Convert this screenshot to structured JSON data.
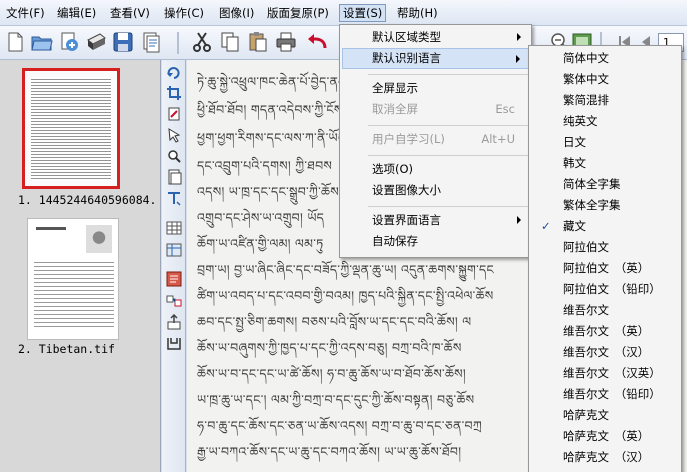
{
  "menubar": {
    "items": [
      "文件(F)",
      "编辑(E)",
      "查看(V)",
      "操作(C)",
      "图像(I)",
      "版面复原(P)",
      "设置(S)",
      "帮助(H)"
    ]
  },
  "thumbnails": {
    "items": [
      {
        "label": "1. 1445244640596084.",
        "selected": true
      },
      {
        "label": "2. Tibetan.tif",
        "selected": false
      }
    ]
  },
  "settings_menu": {
    "items": [
      {
        "label": "默认区域类型",
        "submenu": true
      },
      {
        "label": "默认识别语言",
        "submenu": true,
        "highlighted": true
      },
      {
        "label": "全屏显示"
      },
      {
        "label": "取消全屏",
        "shortcut": "Esc",
        "disabled": true
      },
      {
        "label": "用户自学习(L)",
        "shortcut": "Alt+U",
        "disabled": true
      },
      {
        "label": "选项(O)"
      },
      {
        "label": "设置图像大小"
      },
      {
        "label": "设置界面语言",
        "submenu": true
      },
      {
        "label": "自动保存"
      }
    ]
  },
  "language_menu": {
    "items": [
      "简体中文",
      "繁体中文",
      "繁简混排",
      "纯英文",
      "日文",
      "韩文",
      "简体全字集",
      "繁体全字集",
      "藏文",
      "阿拉伯文",
      "阿拉伯文　（英）",
      "阿拉伯文　（铅印）",
      "维吾尔文",
      "维吾尔文　（英）",
      "维吾尔文　（汉）",
      "维吾尔文　（汉英）",
      "维吾尔文　（铅印）",
      "哈萨克文",
      "哈萨克文　（英）",
      "哈萨克文　（汉）"
    ],
    "checked": "藏文",
    "check_mark": "✓"
  },
  "toolbar_right": {
    "page_box": "1"
  },
  "document": {
    "lines": [
      "ཏེ་ཆུ་སྐྱེ་འཕྲུལ་ཁང་ཆེན་པོ་བྱེད་ནམ",
      "ཕྱི་ཐོབ་ཐོབ།  གདན་འདེབས་ཀྱི་ངོས་ནས",
      "ཕྱག་ཕྱག་རིགས་དང་ལས་ཀ་ནི་ཡོངས་རྫོགས",
      "དང་འབྲུག་པའི་དགས།  ཀྱི་ཐབས",
      "འདས།  ཡ་ཁྲ་དང་དང་སྒྲུབ་ཀྱི་ཆོས",
      "འགྲུབ་དང་ཤེས་ཡ་འགྲུབ།  ཡོད",
      "ཆོག་ཡ་འཛིན་གྱི་ལམ།  ལམ་ཏུ",
      "བྲག་ཡ།  བྱ་ཡ་ཞིང་ཞིང་དང་བཟོད་ཀྱི་ལྡན་ཆུ་ཡ།  འདུན་ཆགས་སྐྱུག་དང",
      "ཚིག་ཡ་འབད་པ་དང་འབབ་གྱི་བའམ།  ཁྱད་པའི་སྐྱིན་དང་སྤྱི་འཕེལ་ཆོས",
      "ཆབ་དང་སྤྱ་ཅིག་ཆགས།  བཅས་པའི་བློས་ཡ་དང་དང་བའི་ཆོས།  ལ",
      "ཆོས་ཡ་བཞུགས་ཀྱི་ཁྱད་པ་དང་ཀྱི་འདས་བཅུ།  བཀྲ་བའི་ཁ་ཆོས",
      "ཆོས་ཡ་བ་དང་དང་ཡ་ཚེ་ཆོས།  ཧ་བ་ཆུ་ཆོས་ཡ་བ་ཐོབ་ཆོས་ཆོས།",
      "ཡ་ཁྲ་ཆུ་ཡ་དང་།  ལམ་ཀྱི་བཀྲ་བ་དང་དུང་ཀྱི་ཆོས་བསྟན།  བཅུ་ཆོས",
      "ཧ་བ་ཆུ་དང་ཆོས་དང་ཅན་ཡ་ཆོས་འདས།  བཀྲ་བ་ཆུ་བ་དང་ཅན་བཀྲ",
      "རྒྱ་ཡ་བཀའ་ཆོས་དང་ཡ་ཆུ་དང་བཀའ་ཆོས།  ཡ་ཡ་ཆུ་ཆོས་ཐོབ།"
    ]
  },
  "colors": {
    "menubar_bg": "#e3eaf5",
    "menu_highlight": "#d5e3f6",
    "thumb_selected_border": "#d62020",
    "panel_bg": "#d8d8d8",
    "document_bg": "#f2f2f0"
  },
  "icons": {
    "toolbar": [
      "new-doc-icon",
      "open-folder-icon",
      "scan-icon",
      "scanner-icon",
      "save-icon",
      "save-as-icon",
      "cut-icon",
      "copy-icon",
      "paste-icon",
      "print-icon",
      "undo-icon"
    ],
    "vstrip": [
      "rotate-icon",
      "crop-icon",
      "deskew-icon",
      "select-icon",
      "zoom-icon",
      "page-icon",
      "text-icon",
      "table-area-icon",
      "image-area-icon",
      "recognize-icon",
      "link-icon",
      "export-icon",
      "reset-icon"
    ]
  }
}
